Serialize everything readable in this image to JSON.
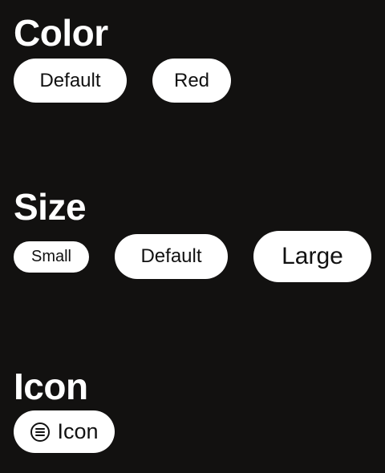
{
  "sections": {
    "color": {
      "title": "Color",
      "buttons": {
        "default": "Default",
        "red": "Red"
      }
    },
    "size": {
      "title": "Size",
      "buttons": {
        "small": "Small",
        "default": "Default",
        "large": "Large"
      }
    },
    "icon": {
      "title": "Icon",
      "buttons": {
        "icon": "Icon",
        "icon_name": "list-icon"
      }
    }
  },
  "colors": {
    "background": "#121110",
    "button_bg": "#ffffff",
    "button_text": "#111111",
    "title_text": "#ffffff"
  }
}
